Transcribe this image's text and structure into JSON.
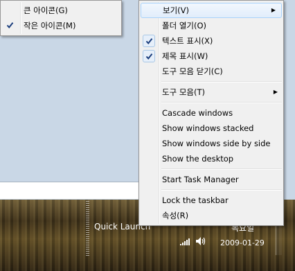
{
  "main_menu": {
    "items": [
      {
        "label": "보기(V)",
        "checked": false,
        "submenu": true,
        "highlighted": true
      },
      {
        "label": "폴더 열기(O)",
        "checked": false
      },
      {
        "label": "텍스트 표시(X)",
        "checked": true
      },
      {
        "label": "제목 표시(W)",
        "checked": true
      },
      {
        "label": "도구 모음 닫기(C)",
        "checked": false
      },
      {
        "label": "도구 모음(T)",
        "checked": false,
        "submenu": true
      },
      {
        "label": "Cascade windows"
      },
      {
        "label": "Show windows stacked"
      },
      {
        "label": "Show windows side by side"
      },
      {
        "label": "Show the desktop"
      },
      {
        "label": "Start Task Manager"
      },
      {
        "label": "Lock the taskbar"
      },
      {
        "label": "속성(R)"
      }
    ]
  },
  "sub_menu": {
    "items": [
      {
        "label": "큰 아이콘(G)",
        "checked": false
      },
      {
        "label": "작은 아이콘(M)",
        "checked": true
      }
    ]
  },
  "taskbar": {
    "quick_launch": "Quick Launch",
    "day": "목요일",
    "date": "2009-01-29"
  },
  "icons": {
    "check": "check-icon",
    "submenu_arrow": "triangle-right-icon",
    "signal": "network-signal-icon",
    "volume": "speaker-icon"
  }
}
